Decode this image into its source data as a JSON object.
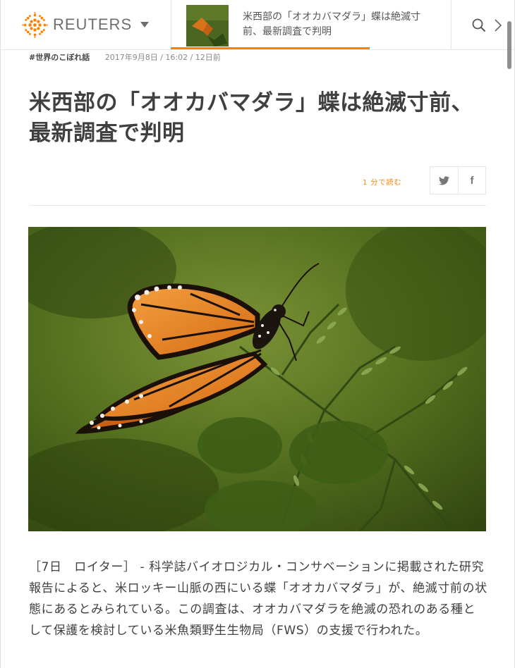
{
  "header": {
    "logo_text": "REUTERS",
    "related_title": "米西部の「オオカバマダラ」蝶は絶滅寸前、最新調査で判明",
    "accent_color": "#ff8000"
  },
  "article": {
    "tag": "#世界のこぼれ話",
    "dateline": "2017年9月8日 / 16:02 / 12日前",
    "headline": "米西部の「オオカバマダラ」蝶は絶滅寸前、最新調査で判明",
    "read_time": "1 分で読む",
    "body": "［7日　ロイター］ - 科学誌バイオロジカル・コンサベーションに掲載された研究報告によると、米ロッキー山脈の西にいる蝶「オオカバマダラ」が、絶滅寸前の状態にあるとみられている。この調査は、オオカバマダラを絶滅の恐れのある種として保護を検討している米魚類野生生物局（FWS）の支援で行われた。"
  },
  "share": {
    "twitter_icon": "twitter-icon",
    "facebook_icon": "facebook-icon",
    "facebook_glyph": "f"
  },
  "icons": {
    "search": "search-icon",
    "next": "chevron-right-icon",
    "menu": "caret-down-icon"
  }
}
